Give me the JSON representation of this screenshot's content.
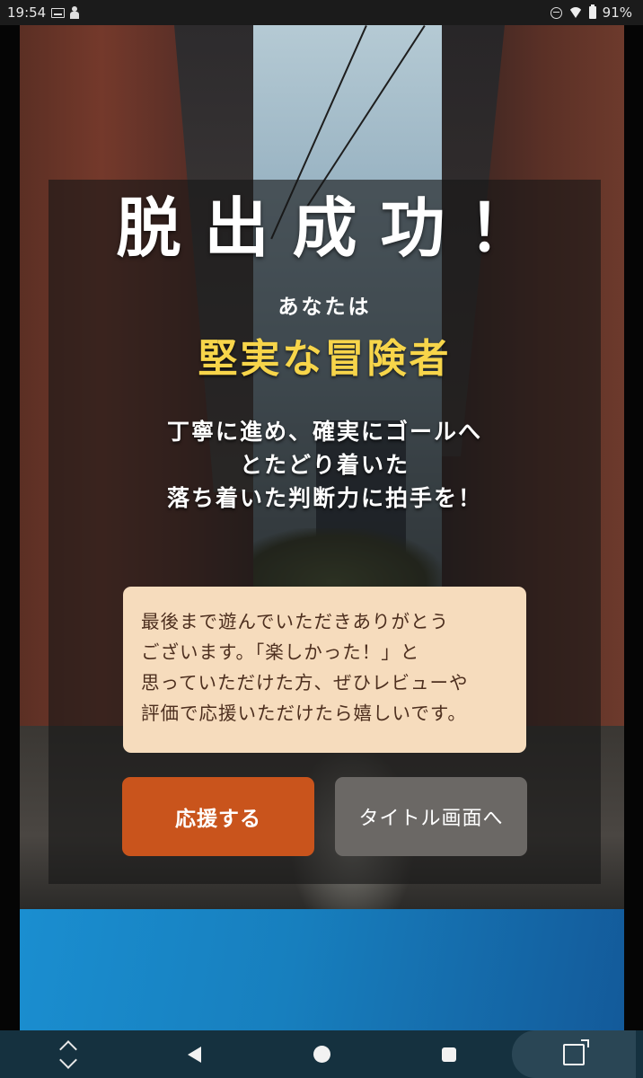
{
  "status_bar": {
    "time": "19:54",
    "battery": "91%"
  },
  "result": {
    "title": "脱出成功！",
    "subtitle": "あなたは",
    "type_name": "堅実な冒険者",
    "description_lines": [
      "丁寧に進め、確実にゴールへ",
      "とたどり着いた",
      "落ち着いた判断力に拍手を！"
    ],
    "thanks_lines": [
      "最後まで遊んでいただきありがとう",
      "ございます。「楽しかった！」と",
      "思っていただけた方、ぜひレビューや",
      "評価で応援いただけたら嬉しいです。"
    ],
    "support_button": "応援する",
    "title_button": "タイトル画面へ"
  },
  "colors": {
    "accent_yellow": "#f7d54a",
    "support_button": "#c9541c",
    "title_button": "#6b6865",
    "thanks_bg": "#f6dcbd",
    "banner_blue": "#1a8ed0",
    "nav_bar": "#15313f"
  },
  "icons": {
    "status": [
      "image-notification-icon",
      "person-notification-icon",
      "do-not-disturb-icon",
      "wifi-icon",
      "battery-icon"
    ],
    "nav": [
      "rotate-icon",
      "back-icon",
      "home-icon",
      "recents-icon",
      "screenshot-crop-icon"
    ]
  }
}
